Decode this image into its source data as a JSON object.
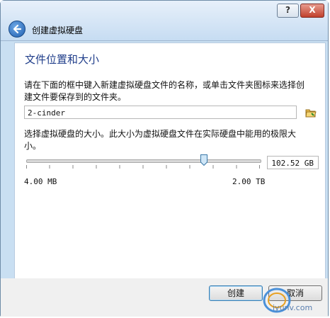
{
  "window": {
    "help_label": "?",
    "close_label": "X",
    "title": "创建虚拟硬盘"
  },
  "page": {
    "heading": "文件位置和大小",
    "description": "请在下面的框中键入新建虚拟硬盘文件的名称，或单击文件夹图标来选择创建文件要保存到的文件夹。",
    "name_value": "2-cinder",
    "size_description": "选择虚拟硬盘的大小。此大小为虚拟硬盘文件在实际硬盘中能用的极限大小。",
    "size_value": "102.52 GB",
    "slider_level": 0.76,
    "min_label": "4.00 MB",
    "max_label": "2.00 TB"
  },
  "buttons": {
    "create": "创建",
    "cancel": "取消"
  },
  "watermark": "iyunv.com"
}
